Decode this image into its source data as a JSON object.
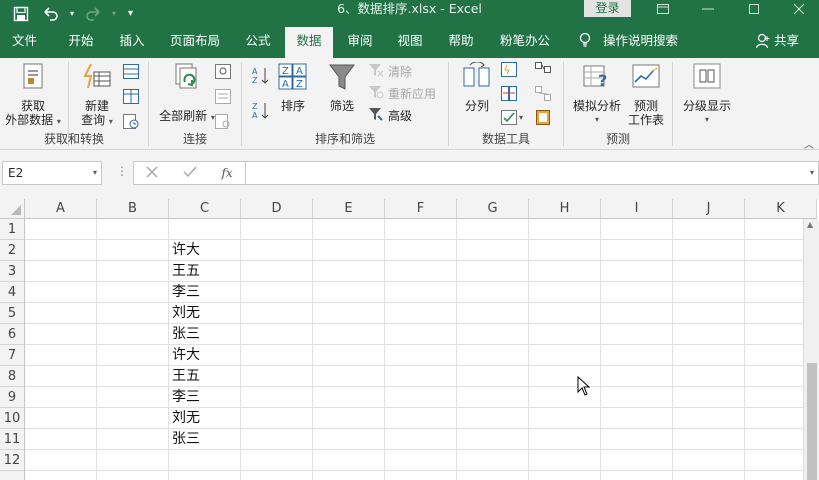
{
  "window": {
    "title": "6、数据排序.xlsx  -  Excel",
    "login_label": "登录",
    "controls": [
      "restore-icon",
      "minimize-icon",
      "maximize-icon",
      "close-icon"
    ]
  },
  "tabs": [
    {
      "label": "文件"
    },
    {
      "label": "开始"
    },
    {
      "label": "插入"
    },
    {
      "label": "页面布局"
    },
    {
      "label": "公式"
    },
    {
      "label": "数据"
    },
    {
      "label": "审阅"
    },
    {
      "label": "视图"
    },
    {
      "label": "帮助"
    },
    {
      "label": "粉笔办公"
    }
  ],
  "tell_me": "操作说明搜索",
  "share": "共享",
  "ribbon": {
    "get_data": {
      "label_line1": "获取",
      "label_line2": "外部数据"
    },
    "new_query": {
      "label_line1": "新建",
      "label_line2": "查询"
    },
    "group_get_transform": "获取和转换",
    "refresh_all": "全部刷新",
    "group_connections": "连接",
    "sort": "排序",
    "filter": "筛选",
    "clear": "清除",
    "reapply": "重新应用",
    "advanced": "高级",
    "group_sort_filter": "排序和筛选",
    "text_to_columns": "分列",
    "group_data_tools": "数据工具",
    "what_if": "模拟分析",
    "forecast": {
      "label_line1": "预测",
      "label_line2": "工作表"
    },
    "group_forecast": "预测",
    "outline": "分级显示"
  },
  "formula_bar": {
    "name_box": "E2",
    "fx_label": "fx",
    "formula": ""
  },
  "sheet": {
    "columns": [
      "A",
      "B",
      "C",
      "D",
      "E",
      "F",
      "G",
      "H",
      "I",
      "J",
      "K"
    ],
    "rows": [
      "1",
      "2",
      "3",
      "4",
      "5",
      "6",
      "7",
      "8",
      "9",
      "10",
      "11",
      "12"
    ],
    "cells_c": [
      "",
      "许大",
      "王五",
      "李三",
      "刘无",
      "张三",
      "许大",
      "王五",
      "李三",
      "刘无",
      "张三",
      ""
    ]
  },
  "colors": {
    "brand": "#217346",
    "ribbon_bg": "#f3f3f3"
  }
}
